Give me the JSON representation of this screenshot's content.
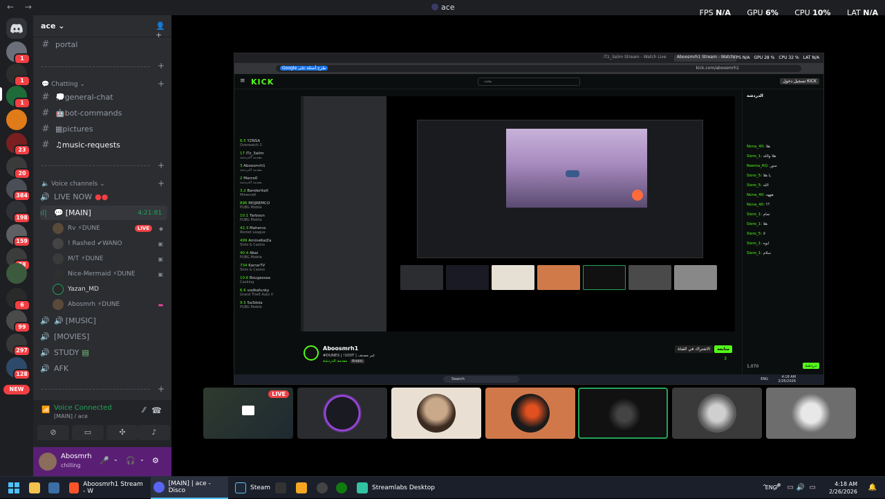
{
  "window": {
    "title": "ace"
  },
  "overlay_stats": {
    "fps_label": "FPS",
    "fps": "N/A",
    "gpu_label": "GPU",
    "gpu": "6%",
    "cpu_label": "CPU",
    "cpu": "10%",
    "lat_label": "LAT",
    "lat": "N/A"
  },
  "rail": {
    "badges": [
      "1",
      "1",
      "1",
      "23",
      "20",
      "384",
      "198",
      "159",
      "78",
      "6",
      "99",
      "297",
      "128"
    ],
    "new_label": "NEW"
  },
  "sidebar": {
    "server_name": "ace",
    "top_channels": [
      {
        "label": "portal"
      }
    ],
    "category_chatting": "Chatting",
    "chatting_channels": [
      {
        "label": "general-chat"
      },
      {
        "label": "bot-commands"
      },
      {
        "label": "pictures"
      },
      {
        "label": "music-requests"
      }
    ],
    "category_voice": "Voice channels",
    "voice_channels": [
      {
        "label": "LIVE NOW"
      },
      {
        "label": "[MAIN]",
        "timer": "4:21:81"
      }
    ],
    "members": [
      {
        "name": "Rv ⚡DUNE",
        "live": "LIVE"
      },
      {
        "name": "! Rashed ✔WANO"
      },
      {
        "name": "M/T ⚡DUNE"
      },
      {
        "name": "Nice-Mermaid ⚡DUNE"
      },
      {
        "name": "Yazan_MD"
      },
      {
        "name": "Abosmrh ⚡DUNE"
      }
    ],
    "more_voice": [
      {
        "label": "[MUSIC]"
      },
      {
        "label": "[MOVIES]"
      },
      {
        "label": "STUDY"
      },
      {
        "label": "AFK"
      }
    ]
  },
  "voice_panel": {
    "title": "Voice Connected",
    "subtitle": "[MAIN] / ace"
  },
  "user_panel": {
    "name": "Abosmrh",
    "status": "chilling"
  },
  "browser": {
    "tabs": [
      "iTz_3alim Stream - Watch Live",
      "Aboosmrh1 Stream - Watch"
    ],
    "overlay": [
      "FPS N/A",
      "GPU 28 %",
      "CPU 32 %",
      "LAT N/A"
    ],
    "google_pill": "Google طرح أسئلة على",
    "url": "kick.com/aboosmrh1",
    "kick_logo": "KICK",
    "search_placeholder": "بحث",
    "login": "تسجيل دخول KICK",
    "left_items": [
      {
        "name": "YZNSA",
        "sub": "Overwatch 2",
        "count": "6.5"
      },
      {
        "name": "iTz_3alim",
        "sub": "مقدمة الدردشة",
        "count": "17"
      },
      {
        "name": "Aboosmrh1",
        "sub": "مقدمة الدردشة",
        "count": "3"
      },
      {
        "name": "Marco0",
        "sub": "مقدمة الدردشة",
        "count": "2"
      },
      {
        "name": "BanderitaX",
        "sub": "Minecraft",
        "count": "3.2"
      },
      {
        "name": "MOJREMCO",
        "sub": "PUBG Mobile",
        "count": "896"
      },
      {
        "name": "Tarboun",
        "sub": "PUBG Mobile",
        "count": "10.1"
      },
      {
        "name": "Maherco",
        "sub": "Rocket League",
        "count": "42.3"
      },
      {
        "name": "AmineKaiZa",
        "sub": "Slots & Casino",
        "count": "499"
      },
      {
        "name": "Abai",
        "sub": "PUBG Mobile",
        "count": "40.4"
      },
      {
        "name": "KarrarTV",
        "sub": "Slots & Casino",
        "count": "734"
      },
      {
        "name": "Bougassaa",
        "sub": "Cooking",
        "count": "10.6"
      },
      {
        "name": "vodkafunky",
        "sub": "Grand Theft Auto V",
        "count": "6.6"
      },
      {
        "name": "5a3dola",
        "sub": "PUBG Mobile",
        "count": "9.5"
      }
    ],
    "stream_name": "Aboosmrh1",
    "stream_title": "#DUNES | !100T | غير مصنف",
    "stream_category": "مقدمة الدردشة",
    "stream_lang": "Arabic",
    "follow": "متابعة",
    "subscribe": "الاشتراك في القناة",
    "viewers": "3",
    "chat_header": "الدردشة",
    "chat_messages": [
      {
        "user": "Nona_40:",
        "text": "هلا"
      },
      {
        "user": "Sioro_1:",
        "text": "هلا والله"
      },
      {
        "user": "Reema_RQ:",
        "text": "منور"
      },
      {
        "user": "Sioro_5:",
        "text": "يا هلا"
      },
      {
        "user": "Sioro_5:",
        "text": "الله"
      },
      {
        "user": "Nona_40:",
        "text": "هههه"
      },
      {
        "user": "Nona_40:",
        "text": "؟؟"
      },
      {
        "user": "Sioro_1:",
        "text": "تمام"
      },
      {
        "user": "Sioro_1:",
        "text": "هلا"
      },
      {
        "user": "Sioro_5:",
        "text": "لا"
      },
      {
        "user": "Sioro_1:",
        "text": "ايوه"
      },
      {
        "user": "Sioro_1:",
        "text": "سلام"
      }
    ],
    "chat_send": "دردشة",
    "chat_count": "1,070",
    "taskbar_search": "Search",
    "taskbar_lang": "ENG",
    "taskbar_time": "4:18 AM",
    "taskbar_date": "2/26/2026"
  },
  "thumbnails": [
    {
      "live": "LIVE"
    },
    {},
    {},
    {},
    {},
    {},
    {}
  ],
  "taskbar": {
    "apps": [
      {
        "label": "Aboosmrh1 Stream - W"
      },
      {
        "label": "[MAIN] | ace - Disco"
      },
      {
        "label": "Steam"
      },
      {
        "label": "Streamlabs Desktop"
      }
    ],
    "lang": "ENG",
    "time": "4:18 AM",
    "date": "2/26/2026"
  }
}
